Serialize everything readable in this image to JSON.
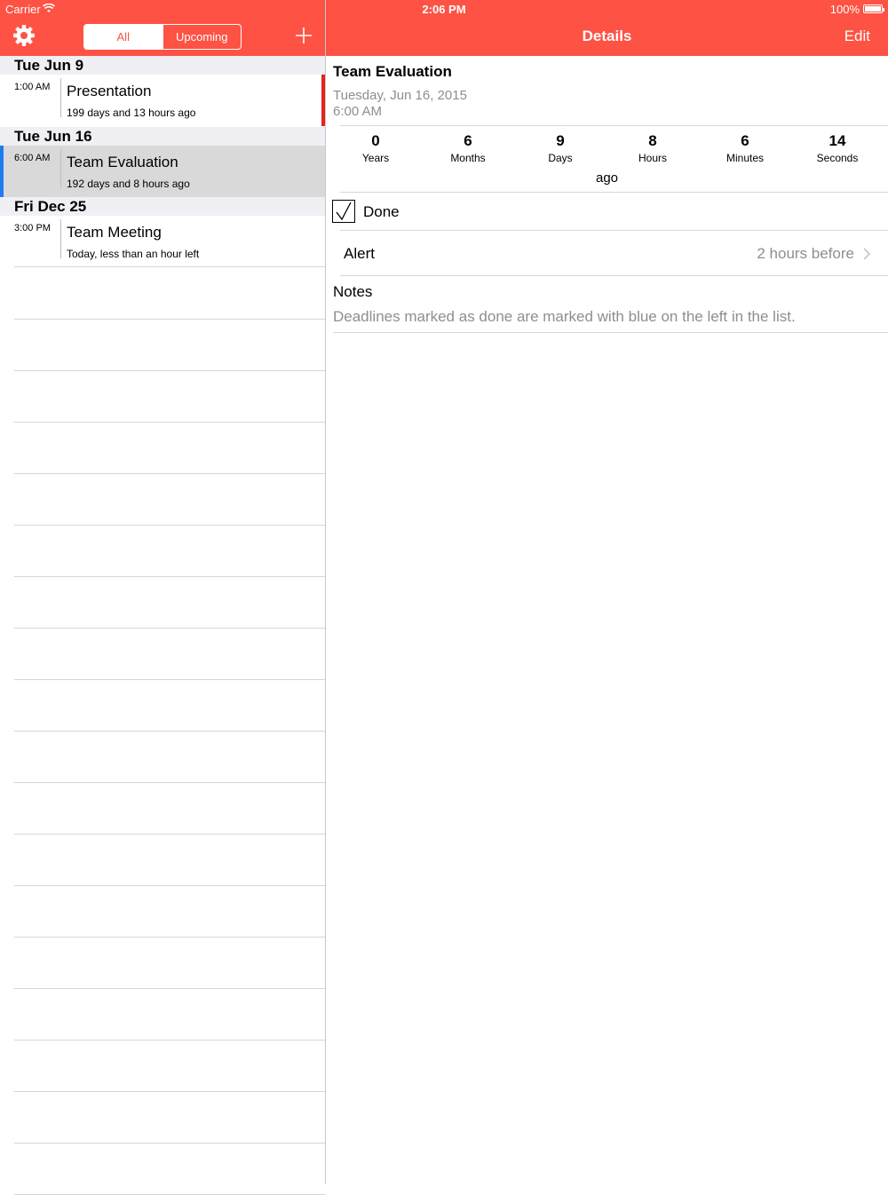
{
  "status_bar": {
    "carrier": "Carrier",
    "time": "2:06 PM",
    "battery": "100%"
  },
  "toolbar": {
    "segments": [
      "All",
      "Upcoming"
    ],
    "selected_segment": "All"
  },
  "details_nav": {
    "title": "Details",
    "edit_label": "Edit"
  },
  "list": {
    "sections": [
      {
        "header": "Tue  Jun 9",
        "items": [
          {
            "time": "1:00 AM",
            "title": "Presentation",
            "subtitle": "199 days and 13 hours ago",
            "marker": "red-right"
          }
        ]
      },
      {
        "header": "Tue  Jun 16",
        "items": [
          {
            "time": "6:00 AM",
            "title": "Team Evaluation",
            "subtitle": "192 days and 8 hours ago",
            "marker": "blue-left",
            "selected": true
          }
        ]
      },
      {
        "header": "Fri  Dec 25",
        "items": [
          {
            "time": "3:00 PM",
            "title": "Team Meeting",
            "subtitle": "Today, less than an hour left"
          }
        ]
      }
    ]
  },
  "details": {
    "name": "Team Evaluation",
    "date": "Tuesday, Jun 16, 2015",
    "time": "6:00 AM",
    "countdown": [
      {
        "value": "0",
        "unit": "Years"
      },
      {
        "value": "6",
        "unit": "Months"
      },
      {
        "value": "9",
        "unit": "Days"
      },
      {
        "value": "8",
        "unit": "Hours"
      },
      {
        "value": "6",
        "unit": "Minutes"
      },
      {
        "value": "14",
        "unit": "Seconds"
      }
    ],
    "ago_label": "ago",
    "done_label": "Done",
    "done_checked": true,
    "alert_label": "Alert",
    "alert_value": "2 hours before",
    "notes_label": "Notes",
    "notes_text": "Deadlines marked as done are marked with blue on the left in the list."
  },
  "colors": {
    "accent": "#fd5244",
    "done_marker": "#1e7bf0",
    "past_marker": "#e4231a"
  }
}
